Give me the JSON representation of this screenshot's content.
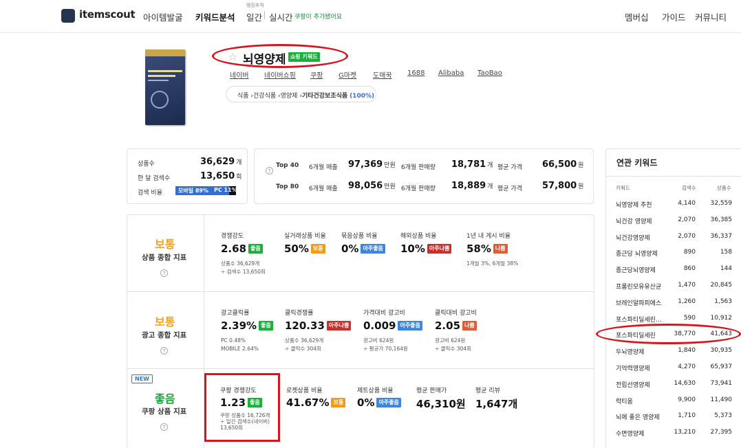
{
  "nav": {
    "brand": "itemscout",
    "items": [
      "아이템발굴",
      "키워드분석"
    ],
    "tiny_label": "랭킹추적",
    "sub_items": [
      "일간",
      "실시간"
    ],
    "notice": "쿠팡이 추가됐어요",
    "right_items": [
      "멤버십",
      "가이드",
      "커뮤니티"
    ]
  },
  "keyword": {
    "title": "뇌영양제",
    "badge": "쇼핑 키워드",
    "market_links": [
      "네이버",
      "네이버쇼핑",
      "쿠팡",
      "G마켓",
      "도매꾹",
      "도매매",
      "1688",
      "Alibaba",
      "TaoBao"
    ],
    "category": [
      "식품",
      "건강식품",
      "영양제",
      "기타건강보조식품"
    ],
    "category_pct": "(100%)"
  },
  "summary": {
    "product_count_label": "상품수",
    "product_count": "36,629",
    "product_count_unit": "개",
    "monthly_search_label": "한 달 검색수",
    "monthly_search": "13,650",
    "monthly_search_unit": "회",
    "search_ratio_label": "검색 비율",
    "mobile_label": "모바일 89%",
    "pc_label": "PC 11%",
    "mobile_ratio": 0.89
  },
  "top": {
    "rows": [
      {
        "label": "Top 40",
        "sales_label": "6개월 매출",
        "sales": "97,369",
        "sales_unit": "만원",
        "qty_label": "6개월 판매량",
        "qty": "18,781",
        "qty_unit": "개",
        "price_label": "평균 가격",
        "price": "66,500",
        "price_unit": "원"
      },
      {
        "label": "Top 80",
        "sales_label": "6개월 매출",
        "sales": "98,056",
        "sales_unit": "만원",
        "qty_label": "6개월 판매량",
        "qty": "18,889",
        "qty_unit": "개",
        "price_label": "평균 가격",
        "price": "57,800",
        "price_unit": "원"
      }
    ]
  },
  "sections": {
    "product": {
      "grade": "보통",
      "title": "상품 종합 지표",
      "m": [
        {
          "label": "경쟁강도",
          "value": "2.68",
          "badge": "좋음",
          "subs": [
            "상품수 36,629개",
            "÷ 검색수 13,650회"
          ]
        },
        {
          "label": "실거래상품 비율",
          "value": "50%",
          "badge": "보통",
          "subs": []
        },
        {
          "label": "묶음상품 비율",
          "value": "0%",
          "badge": "아주좋음",
          "subs": []
        },
        {
          "label": "해외상품 비율",
          "value": "10%",
          "badge": "아주나쁨",
          "subs": []
        },
        {
          "label": "1년 내 게시 비율",
          "value": "58%",
          "badge": "나쁨",
          "subs": [
            "1개월 3%, 6개월 38%"
          ]
        }
      ]
    },
    "ad": {
      "grade": "보통",
      "title": "광고 종합 지표",
      "m": [
        {
          "label": "광고클릭률",
          "value": "2.39%",
          "badge": "좋음",
          "subs": [
            "PC 0.48%",
            "MOBILE 2.64%"
          ]
        },
        {
          "label": "클릭경쟁률",
          "value": "120.33",
          "badge": "아주나쁨",
          "subs": [
            "상품수 36,629개",
            "÷ 클릭수 304회"
          ]
        },
        {
          "label": "가격대비 광고비",
          "value": "0.009",
          "badge": "아주좋음",
          "subs": [
            "광고비 624원",
            "÷ 평균가 70,164원"
          ]
        },
        {
          "label": "클릭대비 광고비",
          "value": "2.05",
          "badge": "나쁨",
          "subs": [
            "광고비 624원",
            "÷ 클릭수 304회"
          ]
        }
      ]
    },
    "coupang": {
      "new": "NEW",
      "grade": "좋음",
      "title": "쿠팡 상품 지표",
      "m": [
        {
          "label": "쿠팡 경쟁강도",
          "value": "1.23",
          "badge": "좋음",
          "subs": [
            "쿠팡 상품수 16,726개",
            "÷ 일간 검색수(네이버)",
            "13,650회"
          ]
        },
        {
          "label": "로켓상품 비율",
          "value": "41.67%",
          "badge": "보통",
          "subs": []
        },
        {
          "label": "제트상품 비율",
          "value": "0%",
          "badge": "아주좋음",
          "subs": []
        },
        {
          "label": "평균 판매가",
          "value": "46,310원",
          "badge": "",
          "subs": []
        },
        {
          "label": "평균 리뷰",
          "value": "1,647개",
          "badge": "",
          "subs": []
        }
      ]
    }
  },
  "related": {
    "title": "연관 키워드",
    "headers": [
      "키워드",
      "검색수",
      "상품수"
    ],
    "rows": [
      [
        "뇌영양제 추천",
        "4,140",
        "32,559"
      ],
      [
        "뇌건강 영양제",
        "2,070",
        "36,385"
      ],
      [
        "뇌건강영양제",
        "2,070",
        "36,337"
      ],
      [
        "종근당 뇌영양제",
        "890",
        "158"
      ],
      [
        "종근당뇌영양제",
        "860",
        "144"
      ],
      [
        "프롬린모유유산균",
        "1,470",
        "20,845"
      ],
      [
        "브레인알파피에스",
        "1,260",
        "1,563"
      ],
      [
        "포스파티딜세린…",
        "590",
        "10,912"
      ],
      [
        "포스파티딜세린",
        "38,770",
        "41,643"
      ],
      [
        "두뇌영양제",
        "1,840",
        "30,935"
      ],
      [
        "기억력영양제",
        "4,270",
        "65,937"
      ],
      [
        "전립선영양제",
        "14,630",
        "73,941"
      ],
      [
        "락티움",
        "9,900",
        "11,490"
      ],
      [
        "뇌에 좋은 영양제",
        "1,710",
        "5,373"
      ],
      [
        "수면영양제",
        "13,210",
        "27,395"
      ]
    ]
  },
  "colors": {
    "good": "#18b13a",
    "normal": "#f19a1c",
    "very_good": "#3d86e0",
    "very_bad": "#c9302c",
    "bad": "#e35b33",
    "highlight": "#d8151f"
  }
}
